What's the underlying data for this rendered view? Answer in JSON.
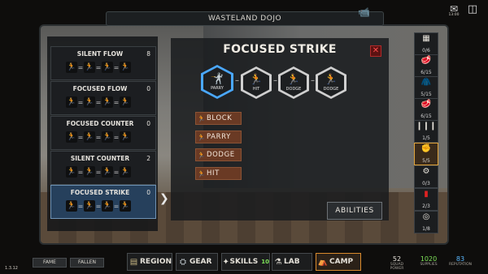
{
  "header": {
    "title": "WASTELAND DOJO"
  },
  "top_right": {
    "badge": "13:00"
  },
  "skills": [
    {
      "name": "SILENT FLOW",
      "count": "8",
      "selected": false
    },
    {
      "name": "FOCUSED FLOW",
      "count": "0",
      "selected": false
    },
    {
      "name": "FOCUSED COUNTER",
      "count": "0",
      "selected": false
    },
    {
      "name": "SILENT COUNTER",
      "count": "2",
      "selected": false
    },
    {
      "name": "FOCUSED STRIKE",
      "count": "0",
      "selected": true
    }
  ],
  "detail": {
    "title": "FOCUSED STRIKE",
    "sequence": [
      {
        "label": "PARRY",
        "icon": "parry-icon",
        "active": true
      },
      {
        "label": "HIT",
        "icon": "hit-icon",
        "active": false
      },
      {
        "label": "DODGE",
        "icon": "dodge-icon",
        "active": false
      },
      {
        "label": "DODGE",
        "icon": "dodge-icon",
        "active": false
      }
    ],
    "options": [
      {
        "label": "BLOCK",
        "icon": "block-icon"
      },
      {
        "label": "PARRY",
        "icon": "parry-icon"
      },
      {
        "label": "DODGE",
        "icon": "dodge-icon"
      },
      {
        "label": "HIT",
        "icon": "hit-icon"
      }
    ],
    "abilities_label": "ABILITIES",
    "close_glyph": "✕"
  },
  "right_slots": [
    {
      "count": "0/6",
      "icon": "bars-icon",
      "selected": false
    },
    {
      "count": "6/15",
      "icon": "meat-icon",
      "selected": false
    },
    {
      "count": "5/15",
      "icon": "jacket-icon",
      "selected": false
    },
    {
      "count": "6/15",
      "icon": "meat-icon",
      "selected": false
    },
    {
      "count": "1/5",
      "icon": "bullets-icon",
      "selected": false
    },
    {
      "count": "5/5",
      "icon": "fist-icon",
      "selected": true
    },
    {
      "count": "0/3",
      "icon": "gears-icon",
      "selected": false
    },
    {
      "count": "2/3",
      "icon": "canister-icon",
      "selected": false
    },
    {
      "count": "1/8",
      "icon": "tire-icon",
      "selected": false
    }
  ],
  "bottom_left": {
    "fame": "FAME",
    "fallen": "FALLEN",
    "version": "1.3.12"
  },
  "nav": [
    {
      "label": "REGION",
      "icon": "map-icon",
      "badge": "",
      "active": false
    },
    {
      "label": "GEAR",
      "icon": "gear-icon",
      "badge": "",
      "active": false
    },
    {
      "label": "SKILLS",
      "icon": "skills-icon",
      "badge": "10",
      "active": false
    },
    {
      "label": "LAB",
      "icon": "lab-icon",
      "badge": "",
      "active": false
    },
    {
      "label": "CAMP",
      "icon": "camp-icon",
      "badge": "",
      "active": true
    }
  ],
  "stats": [
    {
      "value": "52",
      "label": "SQUAD POWER",
      "color": "#e6e2da"
    },
    {
      "value": "1020",
      "label": "SUPPLIES",
      "color": "#7fe35a"
    },
    {
      "value": "83",
      "label": "REPUTATION",
      "color": "#5ab8ff"
    }
  ]
}
